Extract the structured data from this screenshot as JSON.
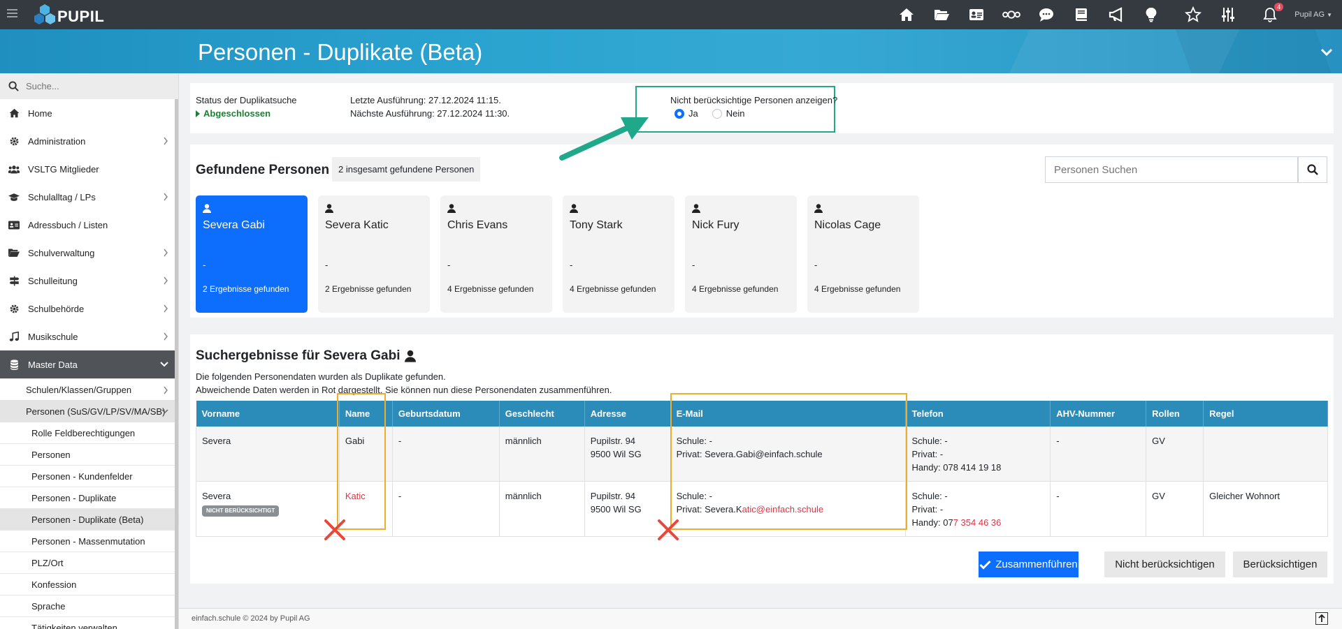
{
  "app": {
    "brand": "PUPIL",
    "user": "Pupil AG",
    "notifications": "4"
  },
  "header": {
    "title": "Personen - Duplikate (Beta)"
  },
  "sidebar": {
    "search_placeholder": "Suche...",
    "items": [
      {
        "label": "Home",
        "icon": "home-icon"
      },
      {
        "label": "Administration",
        "icon": "gear-icon"
      },
      {
        "label": "VSLTG Mitglieder",
        "icon": "users-icon"
      },
      {
        "label": "Schulalltag / LPs",
        "icon": "graduation-cap-icon"
      },
      {
        "label": "Adressbuch / Listen",
        "icon": "address-card-icon"
      },
      {
        "label": "Schulverwaltung",
        "icon": "folder-icon"
      },
      {
        "label": "Schulleitung",
        "icon": "signpost-icon"
      },
      {
        "label": "Schulbehörde",
        "icon": "gear-icon"
      },
      {
        "label": "Musikschule",
        "icon": "music-icon"
      },
      {
        "label": "Master Data",
        "icon": "database-icon"
      }
    ],
    "sub_items": [
      "Schulen/Klassen/Gruppen",
      "Personen (SuS/GV/LP/SV/MA/SB)"
    ],
    "subsub_items": [
      "Rolle Feldberechtigungen",
      "Personen",
      "Personen - Kundenfelder",
      "Personen - Duplikate",
      "Personen - Duplikate (Beta)",
      "Personen - Massenmutation",
      "PLZ/Ort",
      "Konfession",
      "Sprache",
      "Tätigkeiten verwalten"
    ]
  },
  "status": {
    "label": "Status der Duplikatsuche",
    "value": "Abgeschlossen",
    "last_run": "Letzte Ausführung: 27.12.2024 11:15.",
    "next_run": "Nächste Ausführung: 27.12.2024 11:30.",
    "question": "Nicht berücksichtige Personen anzeigen?",
    "option_yes": "Ja",
    "option_no": "Nein"
  },
  "found": {
    "title": "Gefundene Personen",
    "count": "2 insgesamt gefundene Personen",
    "search_placeholder": "Personen Suchen",
    "persons": [
      {
        "name": "Severa Gabi",
        "sub": "-",
        "results": "2 Ergebnisse gefunden"
      },
      {
        "name": "Severa Katic",
        "sub": "-",
        "results": "2 Ergebnisse gefunden"
      },
      {
        "name": "Chris Evans",
        "sub": "-",
        "results": "4 Ergebnisse gefunden"
      },
      {
        "name": "Tony Stark",
        "sub": "-",
        "results": "4 Ergebnisse gefunden"
      },
      {
        "name": "Nick Fury",
        "sub": "-",
        "results": "4 Ergebnisse gefunden"
      },
      {
        "name": "Nicolas Cage",
        "sub": "-",
        "results": "4 Ergebnisse gefunden"
      }
    ]
  },
  "results": {
    "title": "Suchergebnisse für Severa Gabi",
    "desc1": "Die folgenden Personendaten wurden als Duplikate gefunden.",
    "desc2": "Abweichende Daten werden in Rot dargestellt. Sie können nun diese Personendaten zusammenführen.",
    "columns": [
      "Vorname",
      "Name",
      "Geburtsdatum",
      "Geschlecht",
      "Adresse",
      "E-Mail",
      "Telefon",
      "AHV-Nummer",
      "Rollen",
      "Regel"
    ],
    "rows": [
      {
        "vorname": "Severa",
        "badge": "",
        "name": "Gabi",
        "geburtsdatum": "-",
        "geschlecht": "männlich",
        "adresse1": "Pupilstr. 94",
        "adresse2": "9500 Wil SG",
        "email_schule": "Schule: -",
        "email_privat_prefix": "Privat: Severa.Gabi@einfach.schule",
        "email_privat_diff": "",
        "tel_schule": "Schule: -",
        "tel_privat": "Privat: -",
        "tel_handy_prefix": "Handy: 078 414 19 18",
        "tel_handy_diff": "",
        "ahv": "-",
        "rollen": "GV",
        "regel": ""
      },
      {
        "vorname": "Severa",
        "badge": "NICHT BERÜCKSICHTIGT",
        "name": "Katic",
        "geburtsdatum": "-",
        "geschlecht": "männlich",
        "adresse1": "Pupilstr. 94",
        "adresse2": "9500 Wil SG",
        "email_schule": "Schule: -",
        "email_privat_prefix": "Privat: Severa.K",
        "email_privat_diff": "atic@einfach.schule",
        "tel_schule": "Schule: -",
        "tel_privat": "Privat: -",
        "tel_handy_prefix": "Handy: 07",
        "tel_handy_diff": "7 354 46 36",
        "ahv": "-",
        "rollen": "GV",
        "regel": "Gleicher Wohnort"
      }
    ],
    "buttons": {
      "merge": "Zusammenführen",
      "ignore": "Nicht berücksichtigen",
      "consider": "Berücksichtigen"
    }
  },
  "footer": {
    "text": "einfach.schule © 2024 by Pupil AG"
  },
  "colors": {
    "primary": "#0d6efd",
    "header_blue": "#2aa3d0",
    "table_header": "#2b8cba",
    "highlight_orange": "#f0ad2c",
    "arrow_green": "#1fa88a",
    "diff_red": "#dc3545"
  }
}
